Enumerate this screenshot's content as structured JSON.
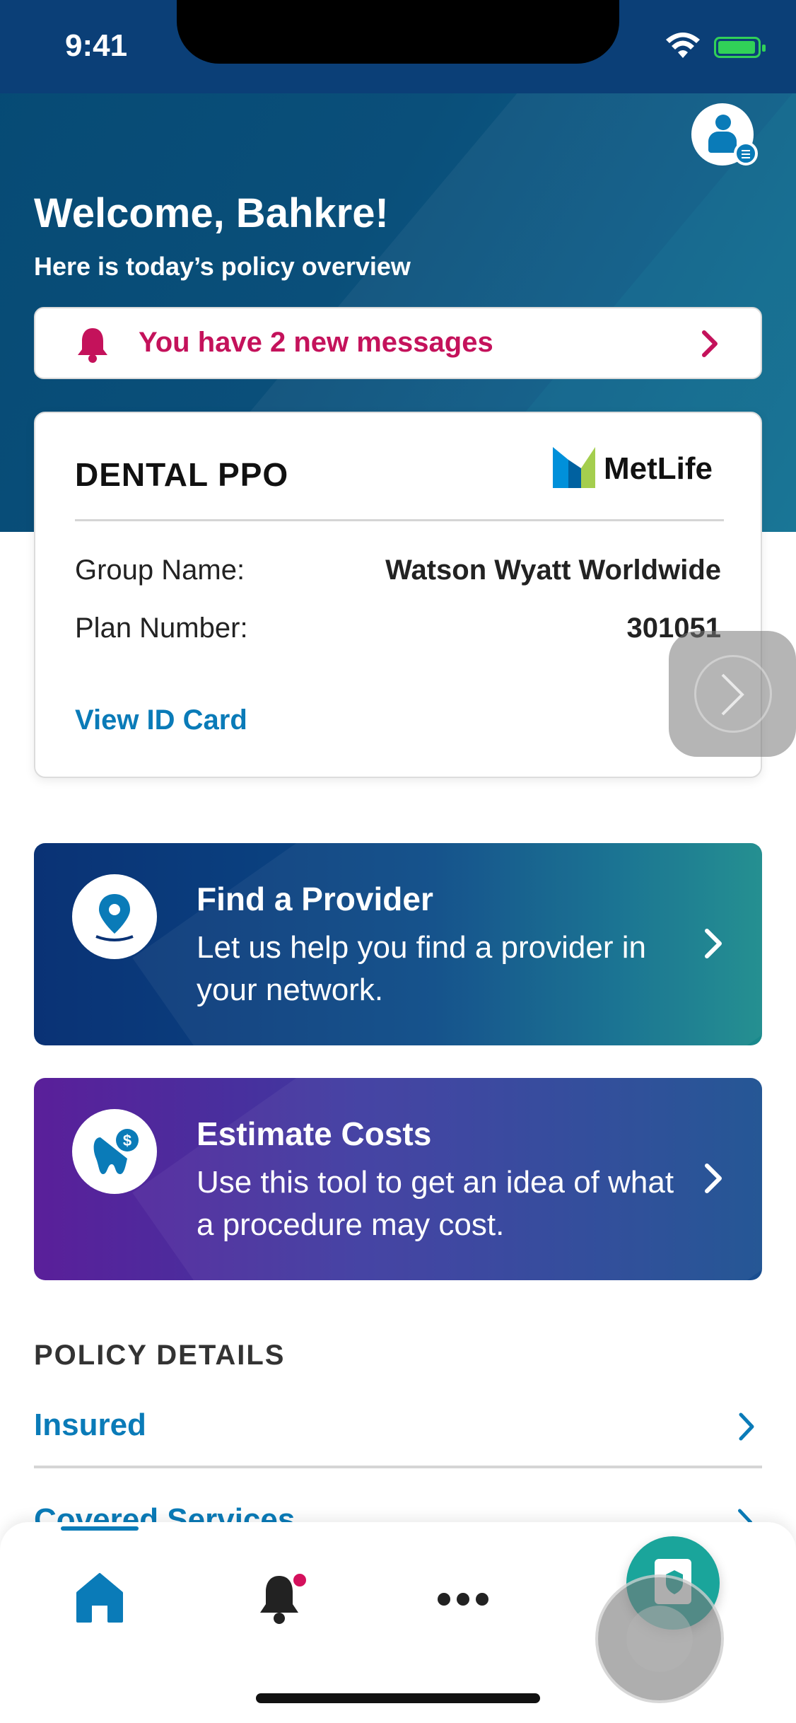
{
  "status_bar": {
    "time": "9:41"
  },
  "header": {
    "welcome": "Welcome, Bahkre!",
    "subtitle": "Here is today’s policy overview"
  },
  "messages_banner": {
    "text": "You have 2 new messages"
  },
  "policy_card": {
    "type": "DENTAL PPO",
    "brand": "MetLife",
    "rows": [
      {
        "label": "Group Name:",
        "value": "Watson Wyatt Worldwide"
      },
      {
        "label": "Plan Number:",
        "value": "301051"
      }
    ],
    "view_id_label": "View ID Card"
  },
  "actions": [
    {
      "title": "Find a Provider",
      "description": "Let us help you find a provider in your network.",
      "icon": "location-pin-icon"
    },
    {
      "title": "Estimate Costs",
      "description": "Use this tool to get an idea of what a procedure may cost.",
      "icon": "tooth-dollar-icon"
    }
  ],
  "policy_details": {
    "title": "POLICY DETAILS",
    "items": [
      {
        "label": "Insured"
      },
      {
        "label": "Covered Services"
      }
    ]
  },
  "tab_bar": {
    "tabs": [
      {
        "name": "home",
        "icon": "home-icon",
        "active": true
      },
      {
        "name": "alerts",
        "icon": "bell-icon",
        "has_badge": true
      },
      {
        "name": "more",
        "icon": "more-dots-icon"
      }
    ],
    "fab_icon": "id-card-shield-icon"
  },
  "colors": {
    "header": "#0a4f7a",
    "accent_blue": "#0a7bb8",
    "message_red": "#c4125b",
    "teal_fab": "#1aa59b"
  }
}
